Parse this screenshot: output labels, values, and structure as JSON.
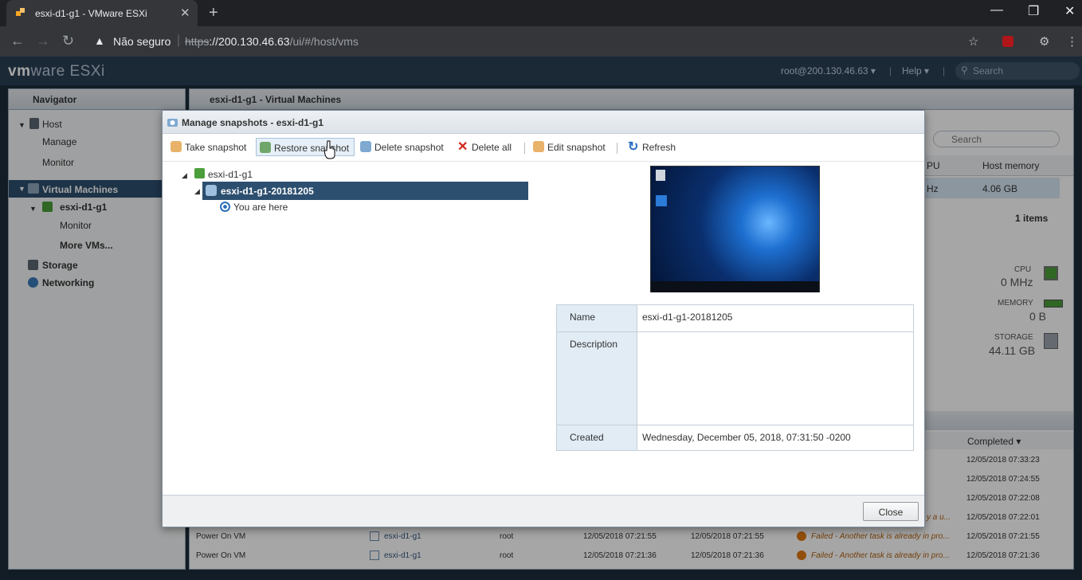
{
  "browser": {
    "tab_title": "esxi-d1-g1 - VMware ESXi",
    "security": "Não seguro",
    "url_scheme": "https",
    "url_host": "://200.130.46.63",
    "url_path": "/ui/#/host/vms"
  },
  "esxi": {
    "logo_vm": "vm",
    "logo_ware": "ware",
    "logo_product": "ESXi",
    "user": "root@200.130.46.63 ▾",
    "help": "Help ▾",
    "search_placeholder": "Search"
  },
  "navigator": {
    "title": "Navigator",
    "host": "Host",
    "manage": "Manage",
    "monitor": "Monitor",
    "virtual_machines": "Virtual Machines",
    "vm": "esxi-d1-g1",
    "vm_monitor": "Monitor",
    "more_vms": "More VMs...",
    "storage": "Storage",
    "networking": "Networking"
  },
  "main": {
    "title": "esxi-d1-g1 - Virtual Machines",
    "search_placeholder": "Search",
    "col_cpu": "PU",
    "col_host_memory": "Host memory",
    "cell_cpu": "Hz",
    "cell_memory": "4.06 GB",
    "items": "1 items",
    "cpu_label": "CPU",
    "cpu_value": "0 MHz",
    "memory_label": "MEMORY",
    "memory_value": "0 B",
    "storage_label": "STORAGE",
    "storage_value": "44.11 GB",
    "completed_col": "Completed ▾",
    "completed_times": [
      "12/05/2018 07:33:23",
      "12/05/2018 07:24:55",
      "12/05/2018 07:22:08",
      "12/05/2018 07:22:01"
    ],
    "trunc_text": "y a u...",
    "tasks": [
      {
        "task": "Power On VM",
        "target": "esxi-d1-g1",
        "initiator": "root",
        "queued": "12/05/2018 07:21:55",
        "started": "12/05/2018 07:21:55",
        "result": "Failed - Another task is already in pro...",
        "completed": "12/05/2018 07:21:55"
      },
      {
        "task": "Power On VM",
        "target": "esxi-d1-g1",
        "initiator": "root",
        "queued": "12/05/2018 07:21:36",
        "started": "12/05/2018 07:21:36",
        "result": "Failed - Another task is already in pro...",
        "completed": "12/05/2018 07:21:36"
      }
    ]
  },
  "dialog": {
    "title": "Manage snapshots - esxi-d1-g1",
    "toolbar": {
      "take": "Take snapshot",
      "restore": "Restore snapshot",
      "delete": "Delete snapshot",
      "delete_all": "Delete all",
      "edit": "Edit snapshot",
      "refresh": "Refresh"
    },
    "tree": {
      "root": "esxi-d1-g1",
      "snapshot": "esxi-d1-g1-20181205",
      "you_are_here": "You are here"
    },
    "props": {
      "name_label": "Name",
      "name_value": "esxi-d1-g1-20181205",
      "description_label": "Description",
      "description_value": "",
      "created_label": "Created",
      "created_value": "Wednesday, December 05, 2018, 07:31:50 -0200"
    },
    "close": "Close"
  },
  "colors": {
    "selection": "#2d4f6f",
    "header": "#2a3f55"
  }
}
